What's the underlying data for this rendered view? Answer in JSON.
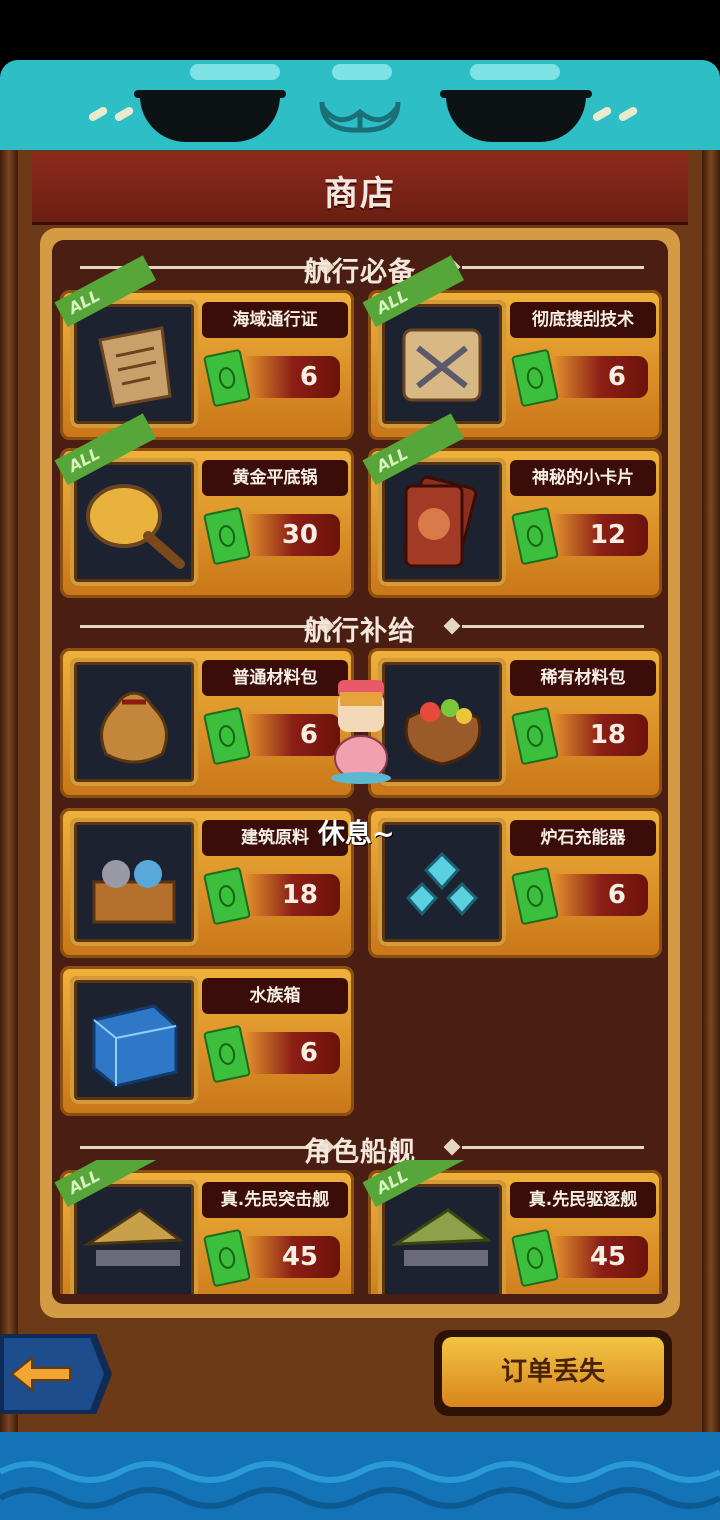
{
  "header": {
    "title": "商店"
  },
  "sections": {
    "essentials": "航行必备",
    "supplies": "航行补给",
    "ships": "角色船舰"
  },
  "all_tag": "ALL",
  "items": {
    "essentials": [
      {
        "name": "海域通行证",
        "price": "6",
        "icon": "sea-map-icon",
        "all": true
      },
      {
        "name": "彻底搜刮技术",
        "price": "6",
        "icon": "scroll-tools-icon",
        "all": true
      },
      {
        "name": "黄金平底锅",
        "price": "30",
        "icon": "golden-pan-icon",
        "all": true
      },
      {
        "name": "神秘的小卡片",
        "price": "12",
        "icon": "dragon-card-icon",
        "all": true
      }
    ],
    "supplies": [
      {
        "name": "普通材料包",
        "price": "6",
        "icon": "material-bag-icon",
        "all": false
      },
      {
        "name": "稀有材料包",
        "price": "18",
        "icon": "rare-material-bag-icon",
        "all": false
      },
      {
        "name": "建筑原料",
        "price": "18",
        "icon": "building-crate-icon",
        "all": false
      },
      {
        "name": "炉石充能器",
        "price": "6",
        "icon": "crystal-charger-icon",
        "all": false
      },
      {
        "name": "水族箱",
        "price": "6",
        "icon": "aquarium-icon",
        "all": false
      }
    ],
    "ships": [
      {
        "name": "真.先民突击舰",
        "price": "45",
        "icon": "assault-ship-icon",
        "all": true
      },
      {
        "name": "真.先民驱逐舰",
        "price": "45",
        "icon": "destroyer-ship-icon",
        "all": true
      }
    ]
  },
  "npc": {
    "status": "休息~"
  },
  "footer": {
    "order_label": "订单丢失"
  },
  "colors": {
    "accent_teal": "#2ebfc6",
    "wood": "#6d3a18",
    "panel_gold": "#d39b43",
    "price_red": "#8b1e16"
  }
}
